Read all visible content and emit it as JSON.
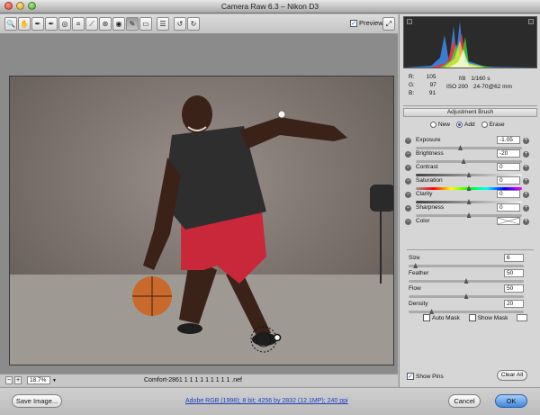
{
  "window": {
    "title": "Camera Raw 6.3  –  Nikon D3"
  },
  "toolbar": {
    "tools": [
      {
        "name": "zoom-tool",
        "glyph": "🔍"
      },
      {
        "name": "hand-tool",
        "glyph": "✋"
      },
      {
        "name": "white-balance-tool",
        "glyph": "✒"
      },
      {
        "name": "color-sampler-tool",
        "glyph": "✒"
      },
      {
        "name": "targeted-adjustment-tool",
        "glyph": "◎"
      },
      {
        "name": "crop-tool",
        "glyph": "⌗"
      },
      {
        "name": "straighten-tool",
        "glyph": "⟋"
      },
      {
        "name": "spot-removal-tool",
        "glyph": "⊛"
      },
      {
        "name": "red-eye-tool",
        "glyph": "◉"
      },
      {
        "name": "adjustment-brush-tool",
        "glyph": "✎"
      },
      {
        "name": "graduated-filter-tool",
        "glyph": "▭"
      },
      {
        "name": "preferences-tool",
        "glyph": "☰"
      },
      {
        "name": "rotate-ccw-tool",
        "glyph": "↺"
      },
      {
        "name": "rotate-cw-tool",
        "glyph": "↻"
      }
    ],
    "preview_label": "Preview",
    "preview_checked": "✓",
    "fullscreen_glyph": "⤢"
  },
  "histogram": {
    "r_label": "R:",
    "r_value": "105",
    "g_label": "G:",
    "g_value": "97",
    "b_label": "B:",
    "b_value": "91",
    "aperture": "f/8",
    "shutter": "1/160 s",
    "iso": "ISO 200",
    "lens": "24-70@62 mm"
  },
  "adjustment_brush": {
    "header": "Adjustment Brush",
    "modes": [
      "New",
      "Add",
      "Erase"
    ],
    "selected_mode": "Add",
    "sliders": [
      {
        "label": "Exposure",
        "value": "-1.05",
        "level": 0.42,
        "track": "plain"
      },
      {
        "label": "Brightness",
        "value": "-20",
        "level": 0.45,
        "track": "plain"
      },
      {
        "label": "Contrast",
        "value": "0",
        "level": 0.5,
        "track": "grad"
      },
      {
        "label": "Saturation",
        "value": "0",
        "level": 0.5,
        "track": "sat"
      },
      {
        "label": "Clarity",
        "value": "0",
        "level": 0.5,
        "track": "grad"
      },
      {
        "label": "Sharpness",
        "value": "0",
        "level": 0.5,
        "track": "plain"
      }
    ],
    "color_label": "Color",
    "brush": [
      {
        "label": "Size",
        "value": "6",
        "level": 0.06
      },
      {
        "label": "Feather",
        "value": "50",
        "level": 0.5
      },
      {
        "label": "Flow",
        "value": "50",
        "level": 0.5
      },
      {
        "label": "Density",
        "value": "20",
        "level": 0.2
      }
    ],
    "auto_mask": "Auto Mask",
    "show_mask": "Show Mask",
    "show_pins": "Show Pins",
    "show_pins_checked": "✓",
    "clear_all": "Clear All"
  },
  "status": {
    "zoom": "18.7%",
    "filename": "Comfort-2861 1 1 1 1 1 1 1 1 1 .nef"
  },
  "footer": {
    "save_image": "Save Image...",
    "workflow": "Adobe RGB (1998); 8 bit; 4256 by 2832 (12.1MP); 240 ppi",
    "cancel": "Cancel",
    "ok": "OK"
  },
  "colors": {
    "ok_blue": "#3f86e0",
    "jersey_red": "#c8283a",
    "shirt": "#2e2e2e",
    "backdrop": "#8a7f79"
  }
}
